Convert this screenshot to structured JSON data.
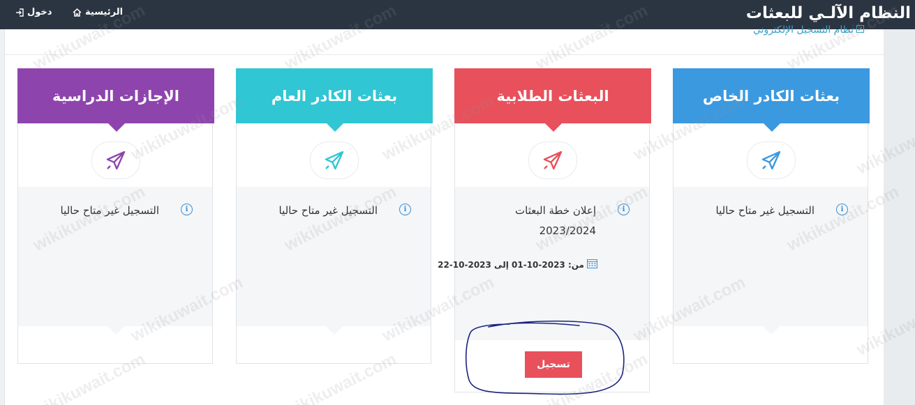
{
  "header": {
    "brand": "النظام الآلـي للبعثات",
    "nav": {
      "home_label": "الرئيسية",
      "login_label": "دخول"
    }
  },
  "breadcrumb": {
    "label": "نظام التسجيل الإلكتروني"
  },
  "colors": {
    "blue": "#3b99e0",
    "red": "#e8505b",
    "teal": "#31c6d4",
    "purple": "#8e44ad",
    "topbar": "#2b3542"
  },
  "cards": [
    {
      "title": "بعثات الكادر الخاص",
      "icon": "airplane-icon",
      "color": "#3b99e0",
      "text": "التسجيل غير متاح حاليا"
    },
    {
      "title": "البعثات الطلابية",
      "icon": "airplane-icon",
      "color": "#e8505b",
      "text": "إعلان خطة البعثات 2023/2024",
      "date": "من: 2023-10-01 إلى 2023-10-22",
      "button": "تسجيل"
    },
    {
      "title": "بعثات الكادر العام",
      "icon": "airplane-icon",
      "color": "#31c6d4",
      "text": "التسجيل غير متاح حاليا"
    },
    {
      "title": "الإجازات الدراسية",
      "icon": "airplane-icon",
      "color": "#8e44ad",
      "text": "التسجيل غير متاح حاليا"
    }
  ],
  "watermark": "wikikuwait.com"
}
